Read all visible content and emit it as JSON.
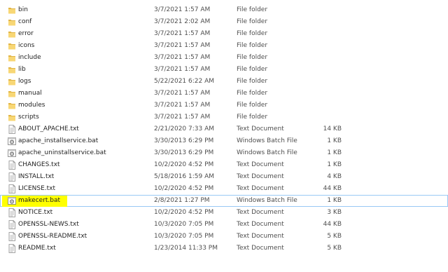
{
  "files": [
    {
      "name": "bin",
      "modified": "3/7/2021 1:57 AM",
      "type": "File folder",
      "size": "",
      "icon": "folder-icon"
    },
    {
      "name": "conf",
      "modified": "3/7/2021 2:02 AM",
      "type": "File folder",
      "size": "",
      "icon": "folder-icon"
    },
    {
      "name": "error",
      "modified": "3/7/2021 1:57 AM",
      "type": "File folder",
      "size": "",
      "icon": "folder-icon"
    },
    {
      "name": "icons",
      "modified": "3/7/2021 1:57 AM",
      "type": "File folder",
      "size": "",
      "icon": "folder-icon"
    },
    {
      "name": "include",
      "modified": "3/7/2021 1:57 AM",
      "type": "File folder",
      "size": "",
      "icon": "folder-icon"
    },
    {
      "name": "lib",
      "modified": "3/7/2021 1:57 AM",
      "type": "File folder",
      "size": "",
      "icon": "folder-icon"
    },
    {
      "name": "logs",
      "modified": "5/22/2021 6:22 AM",
      "type": "File folder",
      "size": "",
      "icon": "folder-icon"
    },
    {
      "name": "manual",
      "modified": "3/7/2021 1:57 AM",
      "type": "File folder",
      "size": "",
      "icon": "folder-icon"
    },
    {
      "name": "modules",
      "modified": "3/7/2021 1:57 AM",
      "type": "File folder",
      "size": "",
      "icon": "folder-icon"
    },
    {
      "name": "scripts",
      "modified": "3/7/2021 1:57 AM",
      "type": "File folder",
      "size": "",
      "icon": "folder-icon"
    },
    {
      "name": "ABOUT_APACHE.txt",
      "modified": "2/21/2020 7:33 AM",
      "type": "Text Document",
      "size": "14 KB",
      "icon": "text-document-icon"
    },
    {
      "name": "apache_installservice.bat",
      "modified": "3/30/2013 6:29 PM",
      "type": "Windows Batch File",
      "size": "1 KB",
      "icon": "batch-file-icon"
    },
    {
      "name": "apache_uninstallservice.bat",
      "modified": "3/30/2013 6:29 PM",
      "type": "Windows Batch File",
      "size": "1 KB",
      "icon": "batch-file-icon"
    },
    {
      "name": "CHANGES.txt",
      "modified": "10/2/2020 4:52 PM",
      "type": "Text Document",
      "size": "1 KB",
      "icon": "text-document-icon"
    },
    {
      "name": "INSTALL.txt",
      "modified": "5/18/2016 1:59 AM",
      "type": "Text Document",
      "size": "4 KB",
      "icon": "text-document-icon"
    },
    {
      "name": "LICENSE.txt",
      "modified": "10/2/2020 4:52 PM",
      "type": "Text Document",
      "size": "44 KB",
      "icon": "text-document-icon"
    },
    {
      "name": "makecert.bat",
      "modified": "2/8/2021 1:27 PM",
      "type": "Windows Batch File",
      "size": "1 KB",
      "icon": "batch-file-icon",
      "selected": true,
      "highlighted": true
    },
    {
      "name": "NOTICE.txt",
      "modified": "10/2/2020 4:52 PM",
      "type": "Text Document",
      "size": "3 KB",
      "icon": "text-document-icon"
    },
    {
      "name": "OPENSSL-NEWS.txt",
      "modified": "10/3/2020 7:05 PM",
      "type": "Text Document",
      "size": "44 KB",
      "icon": "text-document-icon"
    },
    {
      "name": "OPENSSL-README.txt",
      "modified": "10/3/2020 7:05 PM",
      "type": "Text Document",
      "size": "5 KB",
      "icon": "text-document-icon"
    },
    {
      "name": "README.txt",
      "modified": "1/23/2014 11:33 PM",
      "type": "Text Document",
      "size": "5 KB",
      "icon": "text-document-icon"
    }
  ],
  "colors": {
    "folder": "#f8d775",
    "folder_dark": "#e0b445",
    "highlight": "#ffff00",
    "selection_border": "#99c9f5"
  }
}
